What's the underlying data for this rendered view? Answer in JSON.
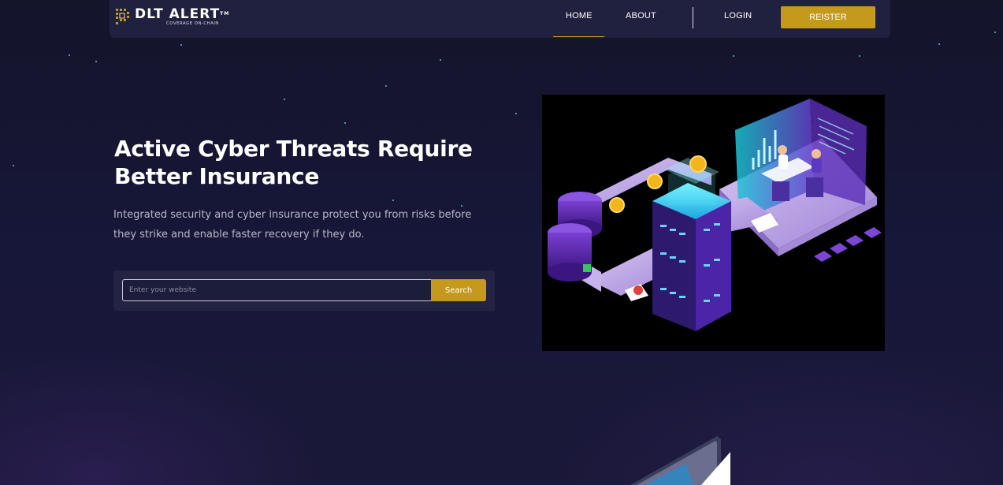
{
  "brand": {
    "name": "DLT ALERT",
    "trademark": "TM",
    "tagline": "COVERAGE ON-CHAIN"
  },
  "nav": {
    "home": "HOME",
    "about": "ABOUT",
    "login": "LOGIN",
    "register": "REISTER",
    "active": "HOME"
  },
  "hero": {
    "title": "Active Cyber Threats Require Better Insurance",
    "subtitle": "Integrated security and cyber insurance protect you from risks before they strike and enable faster recovery if they do."
  },
  "search": {
    "placeholder": "Enter your website",
    "value": "",
    "button": "Search"
  },
  "illustration": {
    "icon": "isometric-cyber-security-data-center",
    "description_icon_names": [
      "server-stack-icon",
      "coin-icon",
      "document-icon",
      "analyst-workstation-icon"
    ]
  },
  "colors": {
    "background": "#15152e",
    "navbar": "#20213f",
    "accent_gold": "#c49a1c",
    "panel": "#232444",
    "text_muted": "#b8b8c8",
    "star": "#7ee2ff"
  }
}
